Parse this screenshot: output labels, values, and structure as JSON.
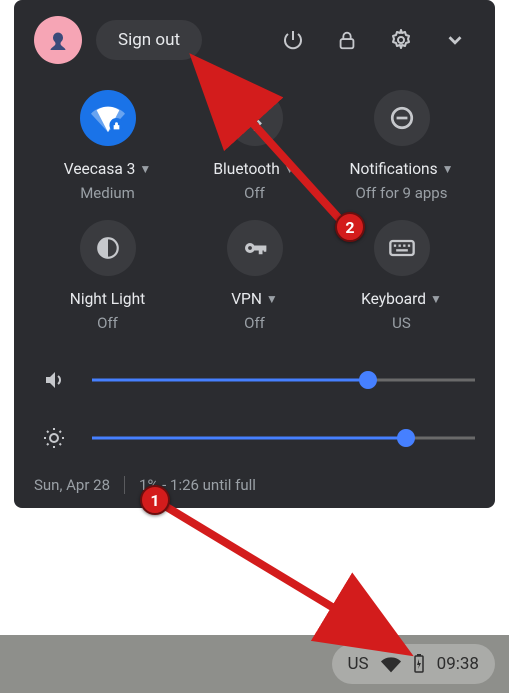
{
  "header": {
    "signout_label": "Sign out"
  },
  "tiles": [
    {
      "label": "Veecasa 3",
      "sub": "Medium",
      "has_chevron": true
    },
    {
      "label": "Bluetooth",
      "sub": "Off",
      "has_chevron": true
    },
    {
      "label": "Notifications",
      "sub": "Off for 9 apps",
      "has_chevron": true
    },
    {
      "label": "Night Light",
      "sub": "Off",
      "has_chevron": false
    },
    {
      "label": "VPN",
      "sub": "Off",
      "has_chevron": true
    },
    {
      "label": "Keyboard",
      "sub": "US",
      "has_chevron": true
    }
  ],
  "sliders": {
    "volume_percent": 72,
    "brightness_percent": 82
  },
  "footer": {
    "date": "Sun, Apr 28",
    "battery": "1% - 1:26 until full"
  },
  "tray": {
    "ime": "US",
    "clock": "09:38"
  },
  "annotations": {
    "badge1": "1",
    "badge2": "2"
  }
}
